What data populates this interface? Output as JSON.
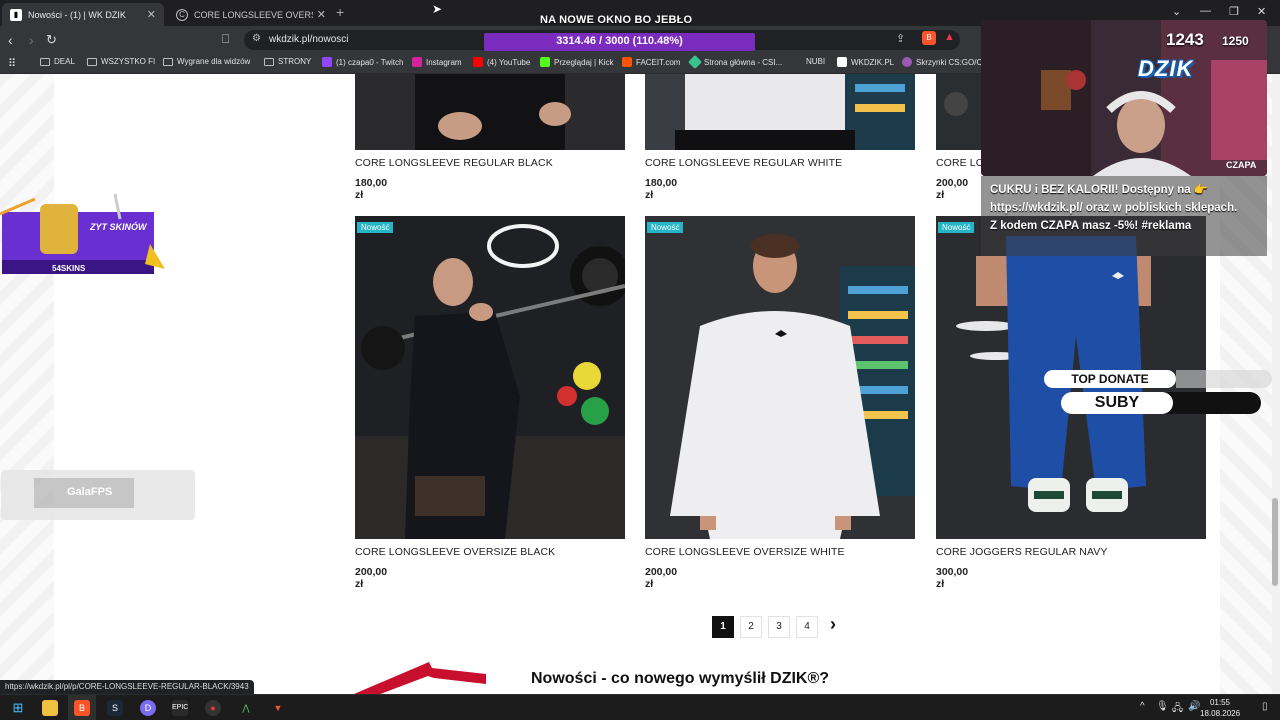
{
  "browser": {
    "tabs": [
      {
        "label": "Nowości - (1) | WK DZIK",
        "active": true
      },
      {
        "label": "CORE LONGSLEEVE OVERSIZE BLACK",
        "active": false
      }
    ],
    "url": "wkdzik.pl/nowosci",
    "bookmarks": [
      "DEAL",
      "WSZYSTKO FI",
      "Wygrane dla widzów",
      "STRONY",
      "(1) czapa0 - Twitch",
      "Instagram",
      "(4) YouTube",
      "Przeglądaj | Kick",
      "FACEIT.com",
      "Strona główna - CSI...",
      "NUBI",
      "WKDZIK.PL",
      "Skrzynki CS:GO/CS"
    ],
    "status_url": "https://wkdzik.pl/pl/p/CORE-LONGSLEEVE-REGULAR-BLACK/3943"
  },
  "products_top": [
    {
      "name": "CORE LONGSLEEVE REGULAR BLACK",
      "price": "180,00 zł"
    },
    {
      "name": "CORE LONGSLEEVE REGULAR WHITE",
      "price": "180,00 zł"
    },
    {
      "name": "CORE LO",
      "price": "200,00 zł"
    }
  ],
  "products": [
    {
      "badge": "Nowość",
      "name": "CORE LONGSLEEVE OVERSIZE BLACK",
      "price": "200,00 zł"
    },
    {
      "badge": "Nowość",
      "name": "CORE LONGSLEEVE OVERSIZE WHITE",
      "price": "200,00 zł"
    },
    {
      "badge": "Nowość",
      "name": "CORE JOGGERS REGULAR NAVY",
      "price": "300,00 zł"
    }
  ],
  "pagination": {
    "pages": [
      "1",
      "2",
      "3",
      "4"
    ],
    "current": "1",
    "next": "›"
  },
  "section_title": "Nowości - co nowego wymyślił DZIK®?",
  "ads": {
    "skins_text": "ZYT SKINÓW",
    "skins_brand": "54SKINS",
    "gala_text": "GalaFPS"
  },
  "overlay": {
    "banner": "NA NOWE OKNO BO JEBŁO",
    "goal": "3314.46 / 3000 (110.48%)",
    "count": "1243",
    "count_max": "1250",
    "logo": "DZIK",
    "cam_name": "CZAPA",
    "chat": "CUKRU i BEZ KALORII! Dostępny na 👉 https://wkdzik.pl/ oraz w pobliskich sklepach. Z kodem CZAPA masz -5%! #reklama",
    "top_donate": "TOP DONATE",
    "suby": "SUBY"
  },
  "taskbar": {
    "time": "01:55",
    "date": "18.08.2026"
  },
  "colors": {
    "badge": "#25b5c7",
    "goal_bar": "#7b2cbf",
    "accent_red": "#c8102e"
  }
}
